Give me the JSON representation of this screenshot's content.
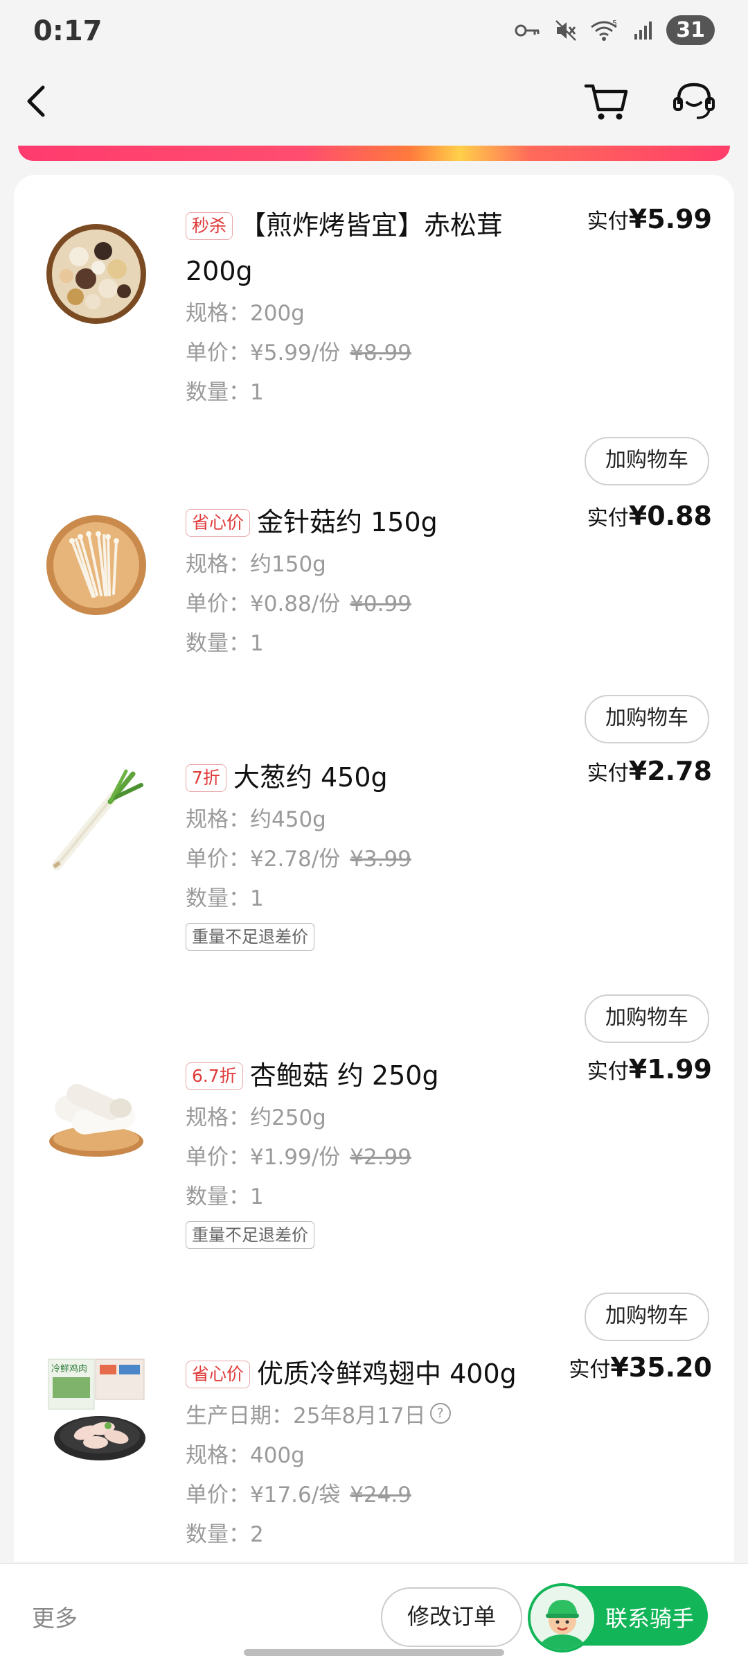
{
  "status_bar": {
    "time": "0:17",
    "battery": "31"
  },
  "nav": {
    "back_label": "back",
    "cart_label": "cart",
    "service_label": "customer service"
  },
  "items": [
    {
      "tag": "秒杀",
      "title": "【煎炸烤皆宜】赤松茸 200g",
      "spec": "规格：200g",
      "unit_price": "单价：¥5.99/份",
      "orig_price": "¥8.99",
      "qty": "数量：1",
      "paid_label": "实付",
      "paid_amount": "¥5.99",
      "button": "加购物车"
    },
    {
      "tag": "省心价",
      "title": "金针菇约 150g",
      "spec": "规格：约150g",
      "unit_price": "单价：¥0.88/份",
      "orig_price": "¥0.99",
      "qty": "数量：1",
      "paid_label": "实付",
      "paid_amount": "¥0.88",
      "button": "加购物车"
    },
    {
      "tag": "7折",
      "title": "大葱约 450g",
      "spec": "规格：约450g",
      "unit_price": "单价：¥2.78/份",
      "orig_price": "¥3.99",
      "qty": "数量：1",
      "note": "重量不足退差价",
      "paid_label": "实付",
      "paid_amount": "¥2.78",
      "button": "加购物车"
    },
    {
      "tag": "6.7折",
      "title": "杏鲍菇 约 250g",
      "spec": "规格：约250g",
      "unit_price": "单价：¥1.99/份",
      "orig_price": "¥2.99",
      "qty": "数量：1",
      "note": "重量不足退差价",
      "paid_label": "实付",
      "paid_amount": "¥1.99",
      "button": "加购物车"
    },
    {
      "tag": "省心价",
      "title": "优质冷鲜鸡翅中 400g",
      "production_date": "生产日期：25年8月17日",
      "spec": "规格：400g",
      "unit_price": "单价：¥17.6/袋",
      "orig_price": "¥24.9",
      "qty": "数量：2",
      "paid_label": "实付",
      "paid_amount": "¥35.20",
      "package_text": "冷鲜鸡肉"
    }
  ],
  "bottom": {
    "more": "更多",
    "modify_order": "修改订单",
    "contact_rider": "联系骑手"
  }
}
